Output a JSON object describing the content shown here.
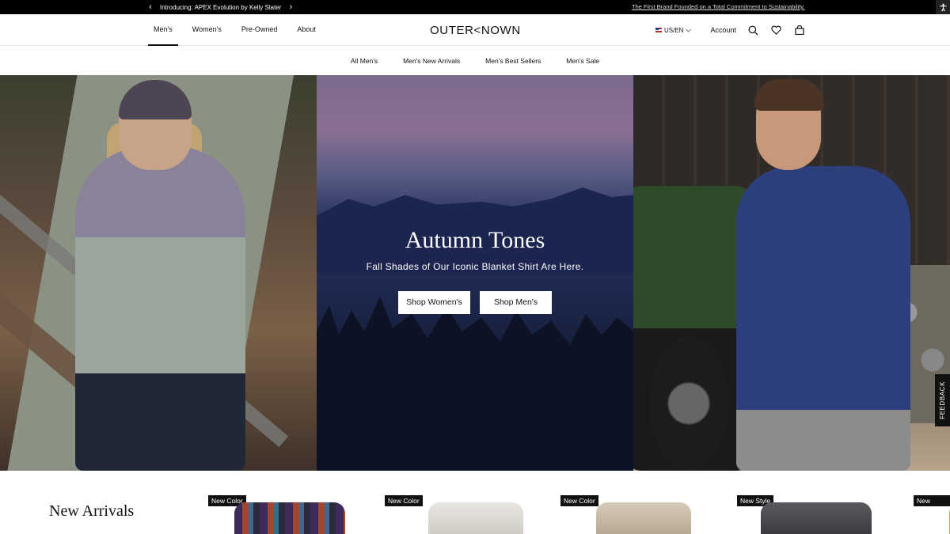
{
  "announcement": {
    "left_text": "Introducing: APEX Evolution by Kelly Slater",
    "prev_glyph": "‹",
    "next_glyph": "›",
    "right_text": "The First Brand Founded on a Total Commitment to Sustainability."
  },
  "header": {
    "nav": [
      {
        "label": "Men's",
        "active": true
      },
      {
        "label": "Women's",
        "active": false
      },
      {
        "label": "Pre-Owned",
        "active": false
      },
      {
        "label": "About",
        "active": false
      }
    ],
    "logo": "OUTER<NOWN",
    "locale": "US/EN",
    "account": "Account",
    "icons": [
      "search-icon",
      "heart-icon",
      "bag-icon"
    ]
  },
  "subnav": [
    "All Men's",
    "Men's New Arrivals",
    "Men's Best Sellers",
    "Men's Sale"
  ],
  "hero": {
    "title": "Autumn Tones",
    "subtitle": "Fall Shades of Our Iconic Blanket Shirt Are Here.",
    "buttons": [
      "Shop Women's",
      "Shop Men's"
    ]
  },
  "feedback": "FEEDBACK",
  "new_arrivals": {
    "title": "New Arrivals",
    "products": [
      {
        "badge": "New Color"
      },
      {
        "badge": "New Color"
      },
      {
        "badge": "New Color"
      },
      {
        "badge": "New Style"
      },
      {
        "badge": "New Style"
      }
    ]
  },
  "colors": {
    "black": "#000000",
    "white": "#ffffff"
  }
}
